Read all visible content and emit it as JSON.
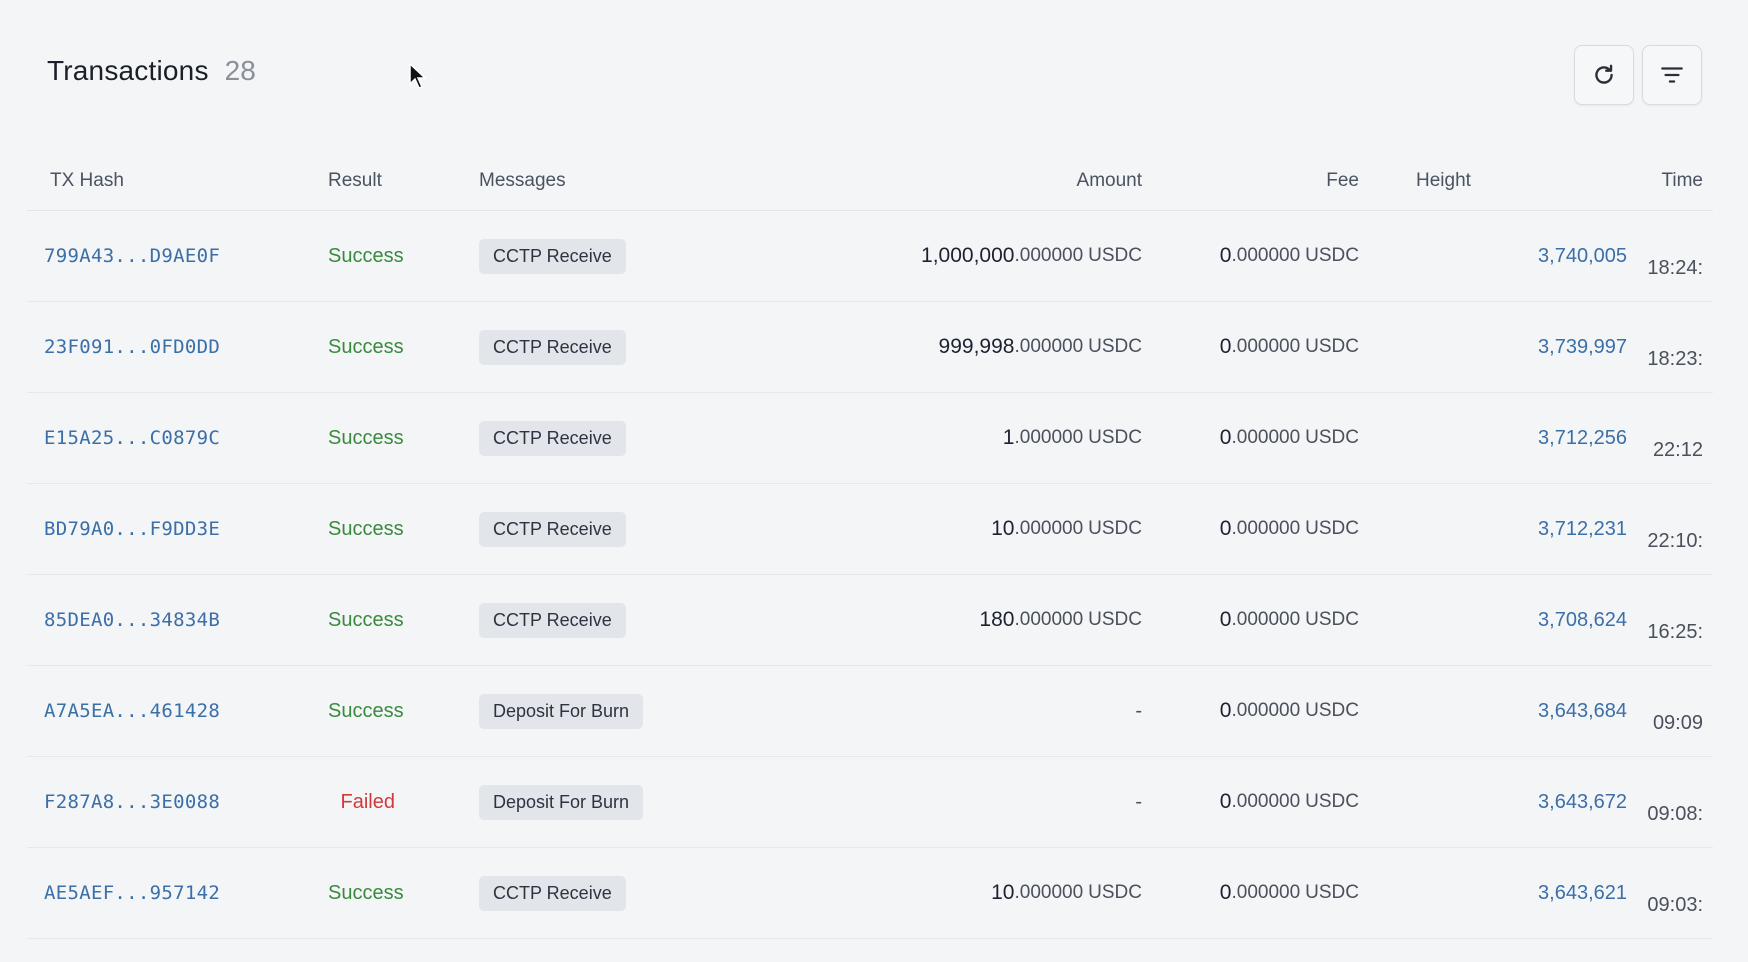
{
  "header": {
    "title": "Transactions",
    "count": "28"
  },
  "toolbar": {
    "refresh_icon": "refresh-icon",
    "filter_icon": "filter-icon"
  },
  "columns": {
    "tx_hash": "TX Hash",
    "result": "Result",
    "messages": "Messages",
    "amount": "Amount",
    "fee": "Fee",
    "height": "Height",
    "time": "Time"
  },
  "colors": {
    "success": "#3a8a3e",
    "failed": "#d23a3a",
    "link": "#3b6fa8"
  },
  "rows": [
    {
      "hash": "799A43...D9AE0F",
      "result": "Success",
      "message": "CCTP Receive",
      "amount_int": "1,000,000",
      "amount_dec": ".000000",
      "amount_unit": "USDC",
      "fee_int": "0",
      "fee_dec": ".000000",
      "fee_unit": "USDC",
      "height": "3,740,005",
      "time": "18:24:"
    },
    {
      "hash": "23F091...0FD0DD",
      "result": "Success",
      "message": "CCTP Receive",
      "amount_int": "999,998",
      "amount_dec": ".000000",
      "amount_unit": "USDC",
      "fee_int": "0",
      "fee_dec": ".000000",
      "fee_unit": "USDC",
      "height": "3,739,997",
      "time": "18:23:"
    },
    {
      "hash": "E15A25...C0879C",
      "result": "Success",
      "message": "CCTP Receive",
      "amount_int": "1",
      "amount_dec": ".000000",
      "amount_unit": "USDC",
      "fee_int": "0",
      "fee_dec": ".000000",
      "fee_unit": "USDC",
      "height": "3,712,256",
      "time": "22:12"
    },
    {
      "hash": "BD79A0...F9DD3E",
      "result": "Success",
      "message": "CCTP Receive",
      "amount_int": "10",
      "amount_dec": ".000000",
      "amount_unit": "USDC",
      "fee_int": "0",
      "fee_dec": ".000000",
      "fee_unit": "USDC",
      "height": "3,712,231",
      "time": "22:10:"
    },
    {
      "hash": "85DEA0...34834B",
      "result": "Success",
      "message": "CCTP Receive",
      "amount_int": "180",
      "amount_dec": ".000000",
      "amount_unit": "USDC",
      "fee_int": "0",
      "fee_dec": ".000000",
      "fee_unit": "USDC",
      "height": "3,708,624",
      "time": "16:25:"
    },
    {
      "hash": "A7A5EA...461428",
      "result": "Success",
      "message": "Deposit For Burn",
      "amount_dash": "-",
      "fee_int": "0",
      "fee_dec": ".000000",
      "fee_unit": "USDC",
      "height": "3,643,684",
      "time": "09:09"
    },
    {
      "hash": "F287A8...3E0088",
      "result": "Failed",
      "message": "Deposit For Burn",
      "amount_dash": "-",
      "fee_int": "0",
      "fee_dec": ".000000",
      "fee_unit": "USDC",
      "height": "3,643,672",
      "time": "09:08:"
    },
    {
      "hash": "AE5AEF...957142",
      "result": "Success",
      "message": "CCTP Receive",
      "amount_int": "10",
      "amount_dec": ".000000",
      "amount_unit": "USDC",
      "fee_int": "0",
      "fee_dec": ".000000",
      "fee_unit": "USDC",
      "height": "3,643,621",
      "time": "09:03:"
    }
  ]
}
